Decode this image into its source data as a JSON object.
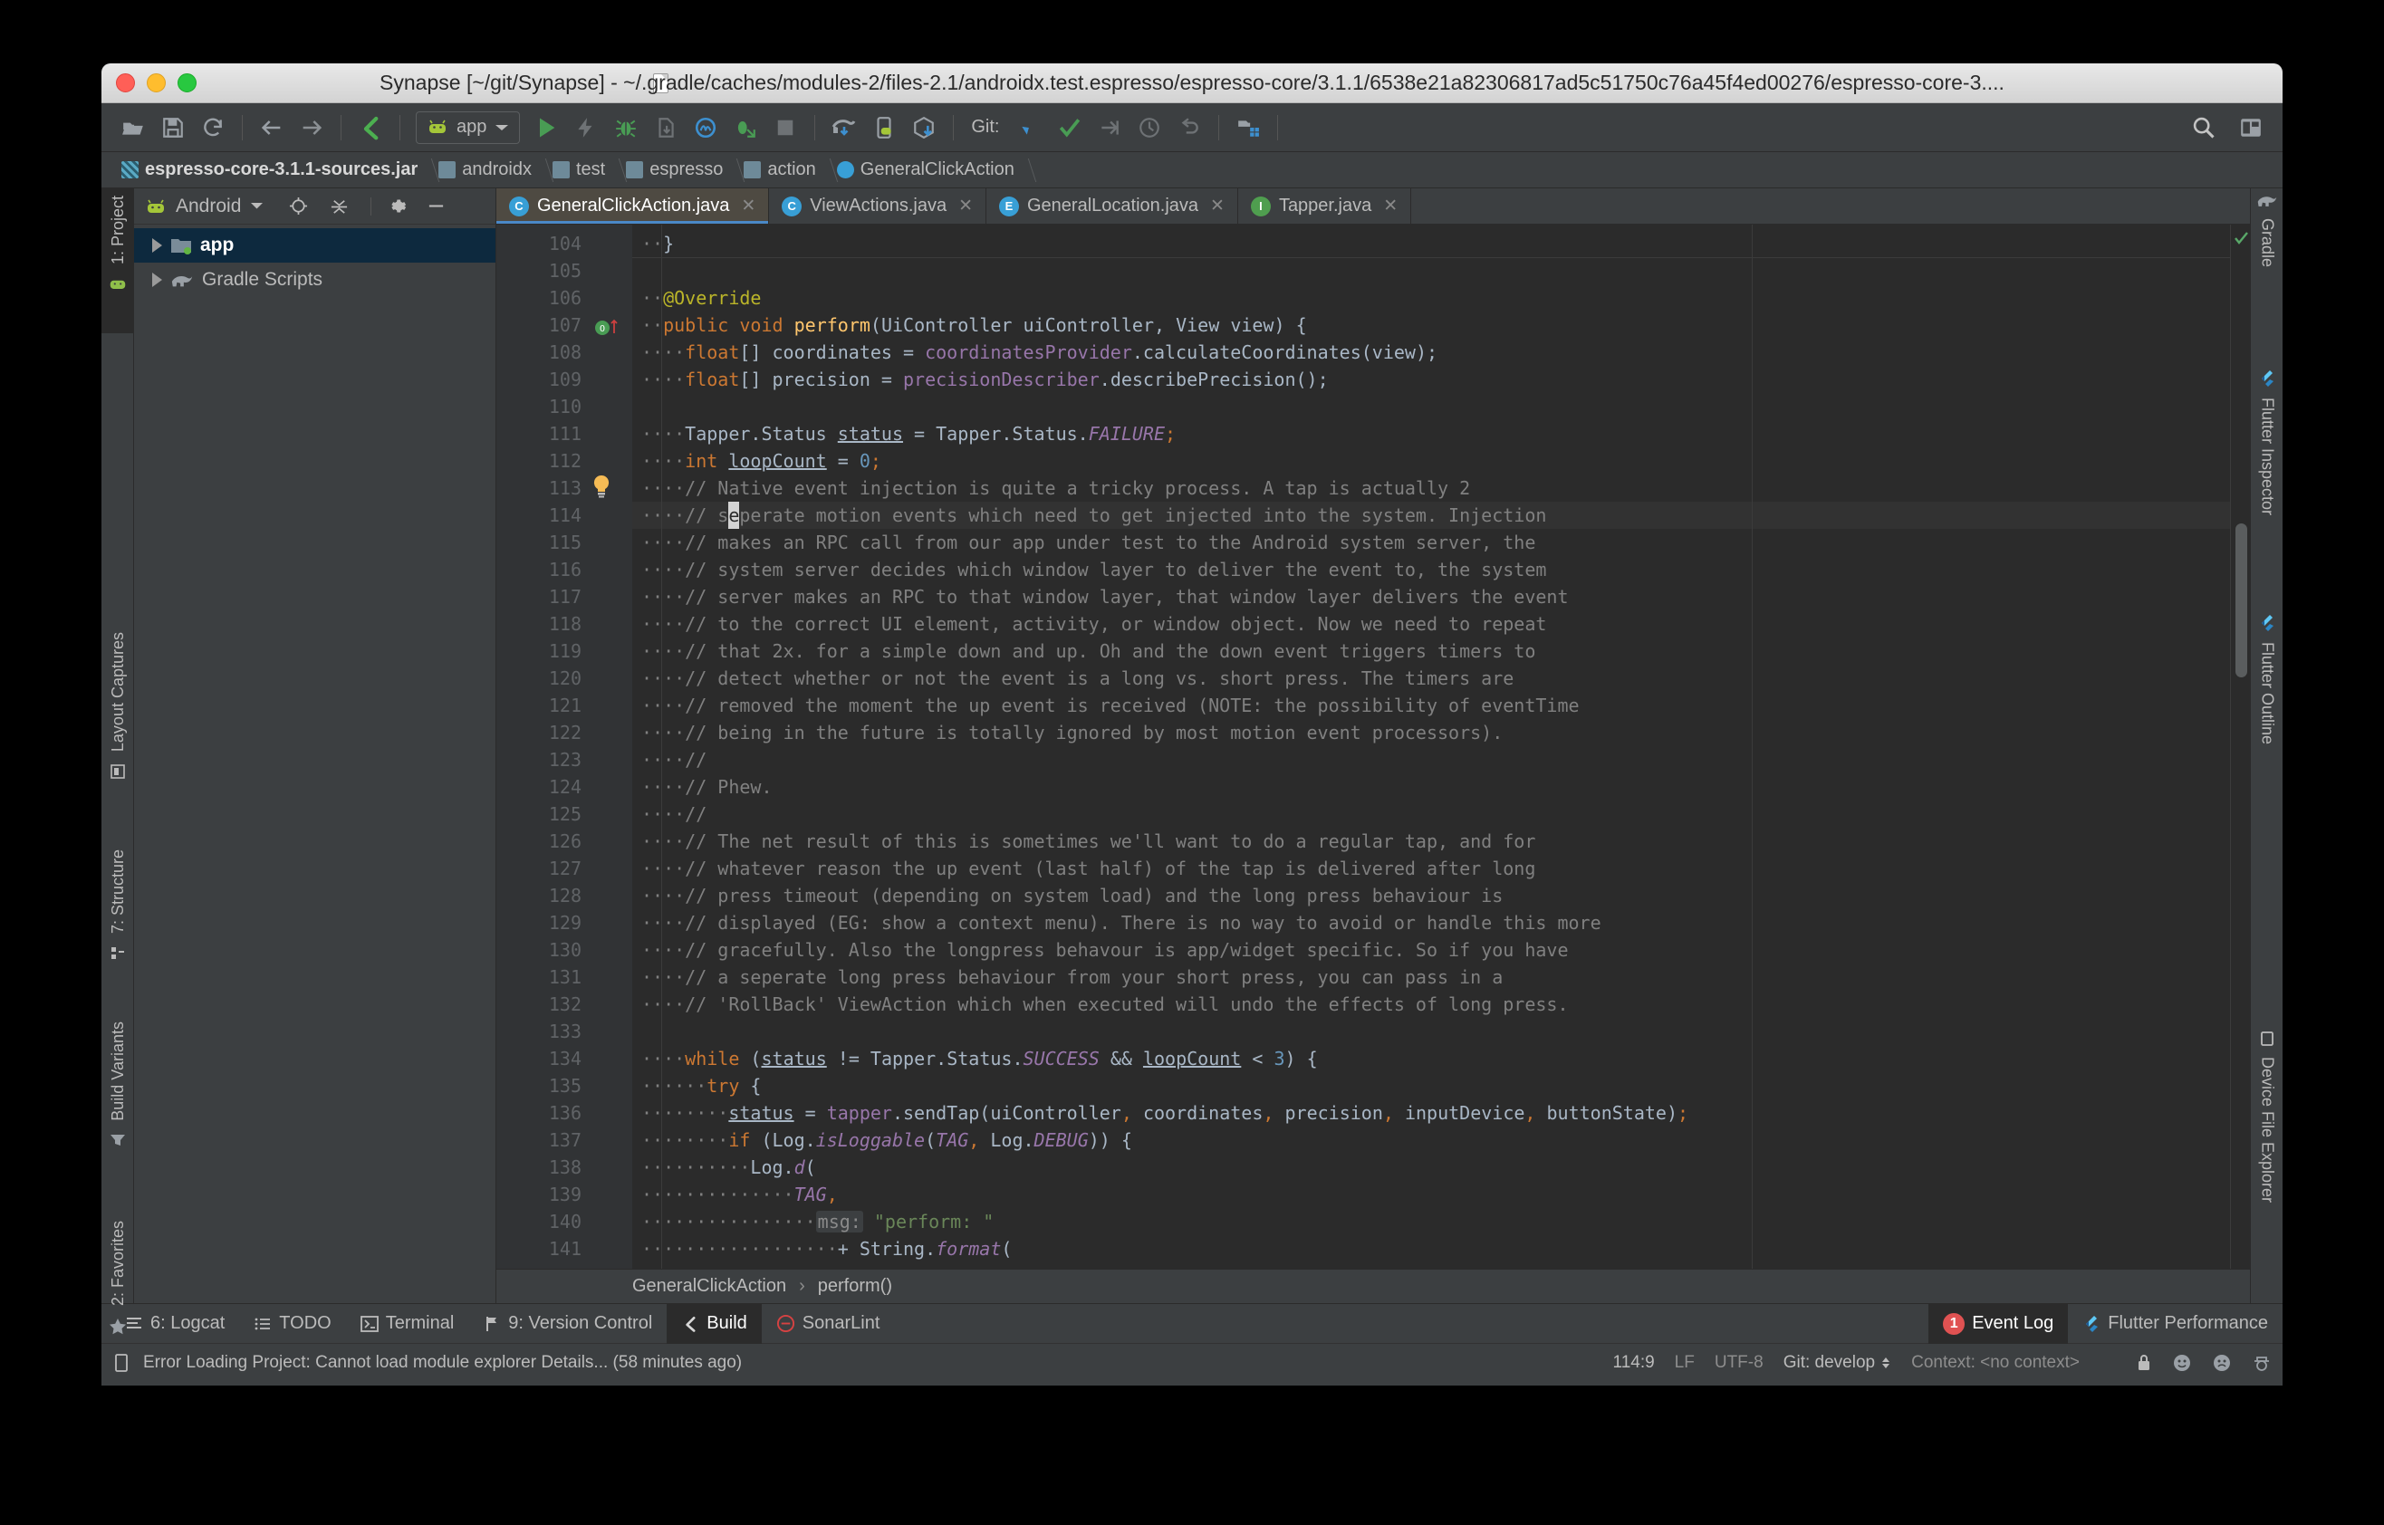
{
  "window": {
    "title": "Synapse [~/git/Synapse] - ~/.gradle/caches/modules-2/files-2.1/androidx.test.espresso/espresso-core/3.1.1/6538e21a82306817ad5c51750c76a45f4ed00276/espresso-core-3...."
  },
  "toolbar": {
    "run_config": "app",
    "git_label": "Git:",
    "icons": [
      "open-project-icon",
      "save-all-icon",
      "sync-icon",
      "back-icon",
      "forward-icon",
      "build-icon",
      "android-icon",
      "chevron-down-icon",
      "run-icon",
      "apply-changes-icon",
      "debug-icon",
      "profile-icon",
      "monitor-icon",
      "attach-debugger-icon",
      "stop-icon",
      "sync-gradle-icon",
      "avd-manager-icon",
      "sdk-manager-icon",
      "git-update-icon",
      "git-commit-icon",
      "git-push-icon",
      "git-history-icon",
      "git-revert-icon",
      "project-structure-icon",
      "search-everywhere-icon",
      "layout-editor-icon"
    ]
  },
  "breadcrumb": {
    "items": [
      {
        "label": "espresso-core-3.1.1-sources.jar",
        "icon": "jar-icon"
      },
      {
        "label": "androidx",
        "icon": "package-icon"
      },
      {
        "label": "test",
        "icon": "package-icon"
      },
      {
        "label": "espresso",
        "icon": "package-icon"
      },
      {
        "label": "action",
        "icon": "package-icon"
      },
      {
        "label": "GeneralClickAction",
        "icon": "class-icon"
      }
    ]
  },
  "left_strip": {
    "top": [
      {
        "label": "1: Project",
        "icon": "project-icon",
        "selected": true
      }
    ],
    "bottom": [
      {
        "label": "Layout Captures",
        "icon": "layout-captures-icon"
      },
      {
        "label": "7: Structure",
        "icon": "structure-icon"
      },
      {
        "label": "Build Variants",
        "icon": "build-variants-icon"
      },
      {
        "label": "2: Favorites",
        "icon": "favorites-star-icon"
      }
    ]
  },
  "right_strip": {
    "top": [
      {
        "label": "Gradle",
        "icon": "gradle-elephant-icon"
      },
      {
        "label": "Flutter Inspector",
        "icon": "flutter-icon"
      },
      {
        "label": "Flutter Outline",
        "icon": "flutter-icon"
      }
    ],
    "bottom": [
      {
        "label": "Device File Explorer",
        "icon": "device-file-explorer-icon"
      }
    ]
  },
  "project_panel": {
    "view_name": "Android",
    "header_icons": [
      "locate-icon",
      "collapse-all-icon",
      "gear-icon",
      "hide-icon"
    ],
    "tree": [
      {
        "label": "app",
        "icon": "module-icon",
        "selected": true
      },
      {
        "label": "Gradle Scripts",
        "icon": "gradle-elephant-icon",
        "selected": false
      }
    ]
  },
  "editor_tabs": [
    {
      "label": "GeneralClickAction.java",
      "icon": "class-icon",
      "letter": "C",
      "color": "#389fd6",
      "active": true
    },
    {
      "label": "ViewActions.java",
      "icon": "class-icon",
      "letter": "C",
      "color": "#389fd6",
      "active": false
    },
    {
      "label": "GeneralLocation.java",
      "icon": "enum-icon",
      "letter": "E",
      "color": "#389fd6",
      "active": false
    },
    {
      "label": "Tapper.java",
      "icon": "interface-icon",
      "letter": "I",
      "color": "#4f9e4f",
      "active": false
    }
  ],
  "editor": {
    "first_line": 104,
    "lines": [
      {
        "n": 104,
        "indent": 2,
        "html": "}"
      },
      {
        "n": 105,
        "indent": 0,
        "html": ""
      },
      {
        "n": 106,
        "indent": 2,
        "html": "@Override"
      },
      {
        "n": 107,
        "indent": 2,
        "html": "public void perform(UiController uiController, View view) {"
      },
      {
        "n": 108,
        "indent": 4,
        "html": "float[] coordinates = coordinatesProvider.calculateCoordinates(view);"
      },
      {
        "n": 109,
        "indent": 4,
        "html": "float[] precision = precisionDescriber.describePrecision();"
      },
      {
        "n": 110,
        "indent": 0,
        "html": ""
      },
      {
        "n": 111,
        "indent": 4,
        "html": "Tapper.Status status = Tapper.Status.FAILURE;"
      },
      {
        "n": 112,
        "indent": 4,
        "html": "int loopCount = 0;"
      },
      {
        "n": 113,
        "indent": 4,
        "html": "// Native event injection is quite a tricky process. A tap is actually 2"
      },
      {
        "n": 114,
        "indent": 4,
        "html": "// seperate motion events which need to get injected into the system. Injection"
      },
      {
        "n": 115,
        "indent": 4,
        "html": "// makes an RPC call from our app under test to the Android system server, the"
      },
      {
        "n": 116,
        "indent": 4,
        "html": "// system server decides which window layer to deliver the event to, the system"
      },
      {
        "n": 117,
        "indent": 4,
        "html": "// server makes an RPC to that window layer, that window layer delivers the event"
      },
      {
        "n": 118,
        "indent": 4,
        "html": "// to the correct UI element, activity, or window object. Now we need to repeat"
      },
      {
        "n": 119,
        "indent": 4,
        "html": "// that 2x. for a simple down and up. Oh and the down event triggers timers to"
      },
      {
        "n": 120,
        "indent": 4,
        "html": "// detect whether or not the event is a long vs. short press. The timers are"
      },
      {
        "n": 121,
        "indent": 4,
        "html": "// removed the moment the up event is received (NOTE: the possibility of eventTime"
      },
      {
        "n": 122,
        "indent": 4,
        "html": "// being in the future is totally ignored by most motion event processors)."
      },
      {
        "n": 123,
        "indent": 4,
        "html": "//"
      },
      {
        "n": 124,
        "indent": 4,
        "html": "// Phew."
      },
      {
        "n": 125,
        "indent": 4,
        "html": "//"
      },
      {
        "n": 126,
        "indent": 4,
        "html": "// The net result of this is sometimes we'll want to do a regular tap, and for"
      },
      {
        "n": 127,
        "indent": 4,
        "html": "// whatever reason the up event (last half) of the tap is delivered after long"
      },
      {
        "n": 128,
        "indent": 4,
        "html": "// press timeout (depending on system load) and the long press behaviour is"
      },
      {
        "n": 129,
        "indent": 4,
        "html": "// displayed (EG: show a context menu). There is no way to avoid or handle this more"
      },
      {
        "n": 130,
        "indent": 4,
        "html": "// gracefully. Also the longpress behavour is app/widget specific. So if you have"
      },
      {
        "n": 131,
        "indent": 4,
        "html": "// a seperate long press behaviour from your short press, you can pass in a"
      },
      {
        "n": 132,
        "indent": 4,
        "html": "// 'RollBack' ViewAction which when executed will undo the effects of long press."
      },
      {
        "n": 133,
        "indent": 0,
        "html": ""
      },
      {
        "n": 134,
        "indent": 4,
        "html": "while (status != Tapper.Status.SUCCESS && loopCount < 3) {"
      },
      {
        "n": 135,
        "indent": 6,
        "html": "try {"
      },
      {
        "n": 136,
        "indent": 8,
        "html": "status = tapper.sendTap(uiController, coordinates, precision, inputDevice, buttonState);"
      },
      {
        "n": 137,
        "indent": 8,
        "html": "if (Log.isLoggable(TAG, Log.DEBUG)) {"
      },
      {
        "n": 138,
        "indent": 10,
        "html": "Log.d("
      },
      {
        "n": 139,
        "indent": 14,
        "html": "TAG,"
      },
      {
        "n": 140,
        "indent": 16,
        "html": "msg: \"perform: \""
      },
      {
        "n": 141,
        "indent": 18,
        "html": "+ String.format("
      }
    ],
    "gutter_markers": {
      "107": "override-method-icon",
      "113": "intention-bulb-icon"
    },
    "breadcrumb": [
      "GeneralClickAction",
      "perform()"
    ],
    "inspection_status": "ok-check-icon"
  },
  "tool_windows": {
    "left": [
      {
        "label": "6: Logcat",
        "icon": "logcat-icon",
        "active": false
      },
      {
        "label": "TODO",
        "icon": "todo-icon",
        "active": false
      },
      {
        "label": "Terminal",
        "icon": "terminal-icon",
        "active": false
      },
      {
        "label": "9: Version Control",
        "icon": "version-control-icon",
        "active": false
      },
      {
        "label": "Build",
        "icon": "build-icon",
        "active": true
      },
      {
        "label": "SonarLint",
        "icon": "sonarlint-icon",
        "active": false
      }
    ],
    "right": [
      {
        "label": "Event Log",
        "icon": "event-log-icon",
        "badge": "1",
        "active": true
      },
      {
        "label": "Flutter Performance",
        "icon": "flutter-icon",
        "badge": "",
        "active": false
      }
    ]
  },
  "status_bar": {
    "message": "Error Loading Project: Cannot load module explorer Details... (58 minutes ago)",
    "message_icon": "notification-icon",
    "caret_position": "114:9",
    "line_separator": "LF",
    "encoding": "UTF-8",
    "git_branch": "Git: develop",
    "context": "Context: <no context>",
    "icons": [
      "lock-icon",
      "happy-face-icon",
      "sad-face-icon",
      "hector-hat-icon"
    ]
  },
  "colors": {
    "accent_blue": "#4a88c7",
    "panel_bg": "#3c3f41",
    "editor_bg": "#2b2b2b",
    "gutter_bg": "#313335",
    "selection_bg": "#0d293e",
    "android_green": "#a4c639",
    "error_red": "#e05252"
  }
}
